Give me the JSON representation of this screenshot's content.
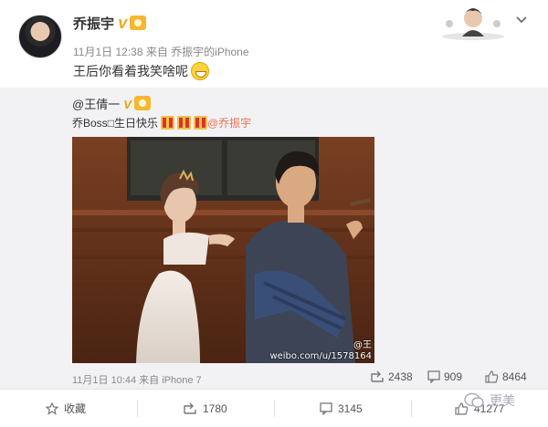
{
  "post": {
    "author": "乔振宇",
    "verified_badge": "V",
    "meta": "11月1日 12:38 来自 乔振宇的iPhone",
    "text": "王后你看着我笑啥呢",
    "emoji": "grin-emoji"
  },
  "repost": {
    "author": "@王倩一",
    "verified_badge": "V",
    "text_prefix": "乔Boss",
    "box_glyph": "□",
    "text_suffix": "生日快乐",
    "mention": "@乔振宇",
    "watermark": "weibo.com/u/1578164",
    "watermark_tag": "@王",
    "meta": "11月1日 10:44 来自 iPhone 7",
    "reposts": "2438",
    "comments": "909",
    "likes": "8464"
  },
  "actions": {
    "favorite": "收藏",
    "repost": "1780",
    "comment": "3145",
    "like": "41277"
  },
  "brand": {
    "name": "更美"
  },
  "colors": {
    "mention": "#eb7350",
    "badge": "#f2a100",
    "repost_bg": "#f2f2f5"
  }
}
